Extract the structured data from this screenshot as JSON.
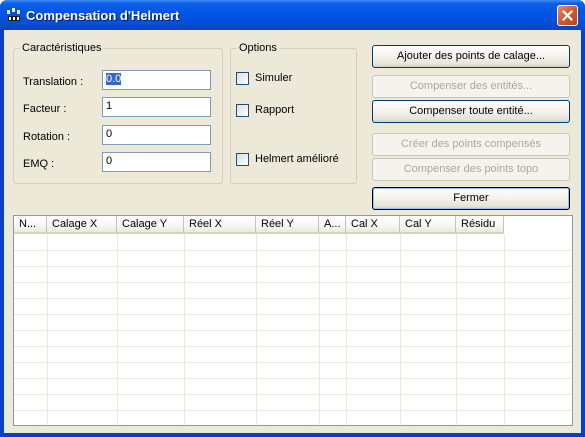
{
  "window": {
    "title": "Compensation d'Helmert"
  },
  "characteristics": {
    "legend": "Caractéristiques",
    "fields": [
      {
        "label": "Translation :",
        "value": "0.0"
      },
      {
        "label": "Facteur :",
        "value": "1"
      },
      {
        "label": "Rotation :",
        "value": "0"
      },
      {
        "label": "EMQ :",
        "value": "0"
      }
    ]
  },
  "options": {
    "legend": "Options",
    "checkboxes": [
      {
        "label": "Simuler",
        "checked": false
      },
      {
        "label": "Rapport",
        "checked": false
      },
      {
        "label": "Helmert amélioré",
        "checked": false
      }
    ]
  },
  "buttons": {
    "add_points": "Ajouter des points de calage...",
    "compensate_entities": "Compenser des entités...",
    "compensate_all": "Compenser toute entité...",
    "create_points": "Créer des points compensés",
    "compensate_topo": "Compenser des points topo",
    "close": "Fermer"
  },
  "table": {
    "columns": [
      "N...",
      "Calage X",
      "Calage Y",
      "Réel X",
      "Réel Y",
      "A...",
      "Cal X",
      "Cal Y",
      "Résidu"
    ],
    "rows": []
  },
  "colors": {
    "titlebar": "#0054e3",
    "face": "#ece9d8",
    "selection": "#316ac5",
    "close": "#d5572c"
  }
}
